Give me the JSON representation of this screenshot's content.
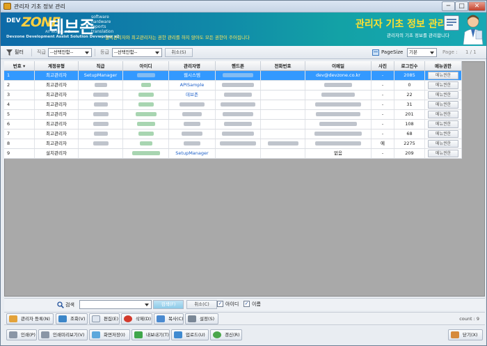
{
  "window": {
    "title": "관리자 기초 정보 관리",
    "min": "─",
    "max": "□",
    "close": "✕"
  },
  "banner": {
    "logo_dev": "DEV",
    "logo_zone": "ZONE",
    "logo_sub": "All Technical Zone",
    "brand": "데브존",
    "brand_words": [
      "software",
      "hardware",
      "reports",
      "translation"
    ],
    "note": "• 설치관리자와 최고관리자는 권한 관리를 하지 않아도 모든 권한이 주어집니다",
    "footer": "Devzone Development Assist Solution Devworker v2",
    "title": "관리자 기초 정보 관리",
    "description": "관리자의 기초 정보를 관리합니다"
  },
  "filter": {
    "filter_label": "필터",
    "rank_label": "직급",
    "rank_value": "--선택안함--",
    "grade_label": "등급",
    "grade_value": "--선택안함--",
    "cancel_label": "취소(S)",
    "pagesize_label": "PageSize",
    "pagesize_value": "기본",
    "page_label": "Page :",
    "page_value": "1 / 1"
  },
  "grid": {
    "columns": [
      "번호",
      "계정유형",
      "직급",
      "아이디",
      "관리자명",
      "핸드폰",
      "전화번호",
      "이메일",
      "사진",
      "로그인수",
      "메뉴권한"
    ],
    "rows": [
      {
        "no": "1",
        "type": "최고관리자",
        "rank": "SetupManager",
        "name": "웹시스템",
        "email": "dev@devzone.co.kr",
        "photo": "-",
        "logins": "2085",
        "menu": "메뉴권한"
      },
      {
        "no": "2",
        "type": "최고관리자",
        "rank": "",
        "name": "APISample",
        "email": "",
        "photo": "-",
        "logins": "0",
        "menu": "메뉴권한"
      },
      {
        "no": "3",
        "type": "최고관리자",
        "rank": "",
        "name": "데브존",
        "email": "",
        "photo": "-",
        "logins": "22",
        "menu": "메뉴권한"
      },
      {
        "no": "4",
        "type": "최고관리자",
        "rank": "",
        "name": "",
        "email": "",
        "photo": "-",
        "logins": "31",
        "menu": "메뉴권한"
      },
      {
        "no": "5",
        "type": "최고관리자",
        "rank": "",
        "name": "",
        "email": "",
        "photo": "-",
        "logins": "201",
        "menu": "메뉴권한"
      },
      {
        "no": "6",
        "type": "최고관리자",
        "rank": "",
        "name": "",
        "email": "",
        "photo": "-",
        "logins": "108",
        "menu": "메뉴권한"
      },
      {
        "no": "7",
        "type": "최고관리자",
        "rank": "",
        "name": "",
        "email": "",
        "photo": "-",
        "logins": "68",
        "menu": "메뉴권한"
      },
      {
        "no": "8",
        "type": "최고관리자",
        "rank": "",
        "name": "",
        "email": "",
        "photo": "예",
        "logins": "2275",
        "menu": "메뉴권한"
      },
      {
        "no": "9",
        "type": "설치관리자",
        "rank": "",
        "name": "SetupManager",
        "email": "없음",
        "photo": "-",
        "logins": "209",
        "menu": "메뉴권한"
      }
    ]
  },
  "search": {
    "label": "검색",
    "search_button": "검색(F)",
    "cancel_button": "취소(C)",
    "check_id": "아이디",
    "check_name": "이름"
  },
  "toolbar": {
    "register": "관리자 등록(N)",
    "view": "조회(V)",
    "edit": "편집(E)",
    "delete": "삭제(D)",
    "copy": "복사(C)",
    "settings": "설정(S)",
    "count": "count : 9"
  },
  "bottom": {
    "print": "인쇄(P)",
    "print_preview": "인쇄미리보기(V)",
    "save_screen": "화면저장(I)",
    "export": "내보내기(T)",
    "upload": "업로드(U)",
    "refresh": "갱신(R)",
    "close": "닫기(X)"
  },
  "colors": {
    "selected_row": "#3399ff",
    "banner_left": "#0d6aa8",
    "banner_right": "#18a8b4",
    "title_yellow": "#ffe030"
  }
}
